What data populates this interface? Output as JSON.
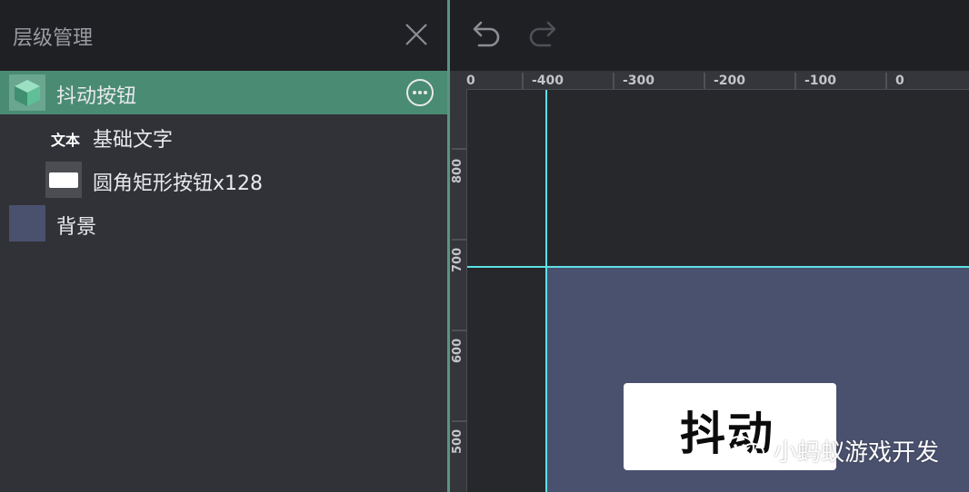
{
  "panel": {
    "title": "层级管理",
    "layers": [
      {
        "label": "抖动按钮",
        "icon": "node-cube-icon",
        "selected": true
      },
      {
        "label": "基础文字",
        "icon": "text-label-icon",
        "icon_text": "文本"
      },
      {
        "label": "圆角矩形按钮x128",
        "icon": "sprite-thumbnail-icon"
      },
      {
        "label": "背景",
        "icon": "color-swatch-icon",
        "swatch_color": "#4a516e"
      }
    ]
  },
  "ruler": {
    "top_labels": [
      "0",
      "-400",
      "-300",
      "-200",
      "-100",
      "0"
    ],
    "left_labels": [
      "800",
      "700",
      "600",
      "500"
    ]
  },
  "scene": {
    "button_text": "抖动",
    "background_color": "#4a516e",
    "guide_color": "#5de0e6"
  },
  "watermark": {
    "text": "小蚂蚁游戏开发",
    "icon": "wechat-icon"
  },
  "colors": {
    "accent": "#4a8b73",
    "panel_bg": "#303237",
    "header_bg": "#1f2024"
  }
}
